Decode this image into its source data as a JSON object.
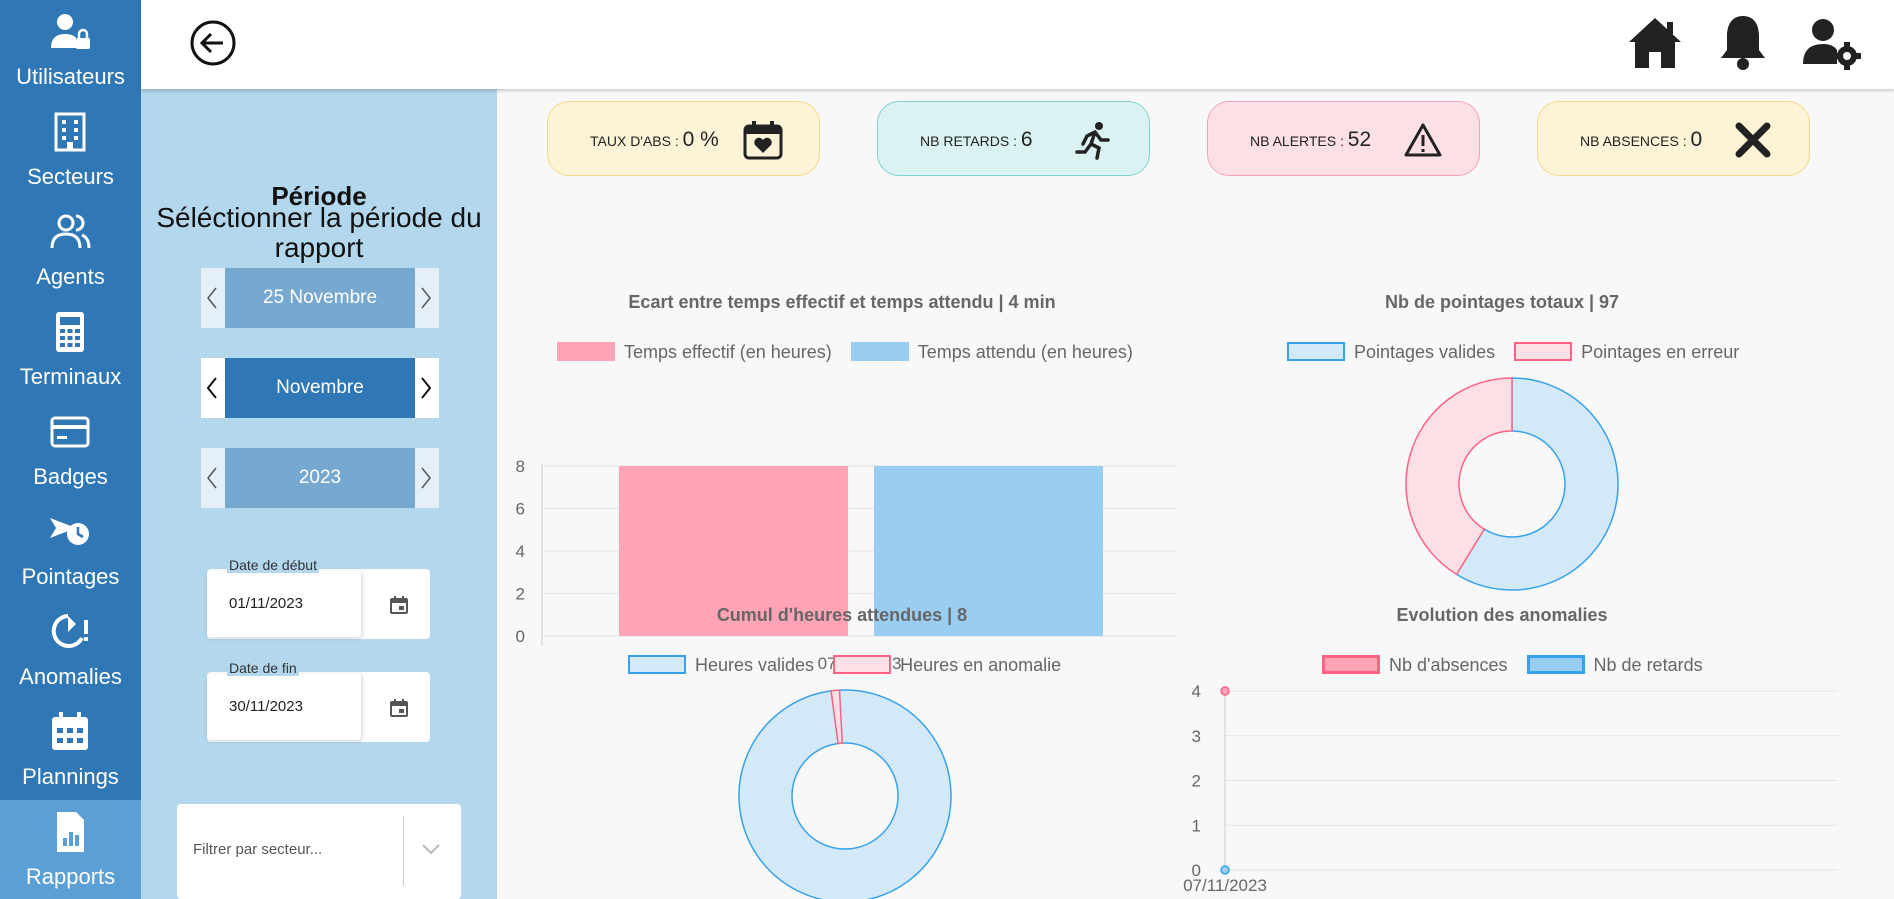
{
  "nav": [
    {
      "label": "Utilisateurs",
      "icon": "user-lock-icon"
    },
    {
      "label": "Secteurs",
      "icon": "building-icon"
    },
    {
      "label": "Agents",
      "icon": "users-icon"
    },
    {
      "label": "Terminaux",
      "icon": "calculator-icon"
    },
    {
      "label": "Badges",
      "icon": "card-icon"
    },
    {
      "label": "Pointages",
      "icon": "clock-arrow-icon"
    },
    {
      "label": "Anomalies",
      "icon": "pie-alert-icon"
    },
    {
      "label": "Plannings",
      "icon": "calendar-icon"
    },
    {
      "label": "Rapports",
      "icon": "report-icon"
    }
  ],
  "period": {
    "title": "Période",
    "subtitle": "Séléctionner la période du rapport",
    "day": "25 Novembre",
    "month": "Novembre",
    "year": "2023",
    "start_label": "Date de début",
    "start_value": "01/11/2023",
    "end_label": "Date de fin",
    "end_value": "30/11/2023",
    "filter_placeholder": "Filtrer par secteur..."
  },
  "kpis": [
    {
      "label": "TAUX D'ABS :",
      "value": "0 %",
      "icon": "calendar-heart-icon",
      "bg": "#fdf4d7",
      "border": "#f5d98a"
    },
    {
      "label": "NB RETARDS :",
      "value": "6",
      "icon": "running-icon",
      "bg": "#daf2f1",
      "border": "#7fd3cf"
    },
    {
      "label": "NB ALERTES :",
      "value": "52",
      "icon": "warning-icon",
      "bg": "#fde0e6",
      "border": "#f5a3b5"
    },
    {
      "label": "NB ABSENCES :",
      "value": "0",
      "icon": "x-icon",
      "bg": "#fdf4d7",
      "border": "#f5d98a"
    }
  ],
  "colors": {
    "pink": "#ffa3b7",
    "blue": "#99cdf2",
    "lightblue": "#d4e9f8",
    "lightpink": "#fde0e6",
    "border_blue": "#36a2eb",
    "border_pink": "#ff6384"
  },
  "chart_data": [
    {
      "type": "bar",
      "title": "Ecart entre temps effectif et temps attendu | 4 min",
      "categories": [
        "07/11/2023"
      ],
      "series": [
        {
          "name": "Temps effectif (en heures)",
          "values": [
            8
          ]
        },
        {
          "name": "Temps attendu (en heures)",
          "values": [
            8
          ]
        }
      ],
      "ylim": [
        0,
        8
      ],
      "yticks": [
        "0",
        "2",
        "4",
        "6",
        "8"
      ]
    },
    {
      "type": "pie",
      "title": "Nb de pointages totaux | 97",
      "labels": [
        "Pointages valides",
        "Pointages en erreur"
      ],
      "values": [
        57,
        40
      ]
    },
    {
      "type": "pie",
      "title": "Cumul d'heures attendues | 8",
      "labels": [
        "Heures valides",
        "Heures en anomalie"
      ],
      "values": [
        7.9,
        0.1
      ]
    },
    {
      "type": "line",
      "title": "Evolution des anomalies",
      "x": [
        "07/11/2023"
      ],
      "series": [
        {
          "name": "Nb d'absences",
          "values": [
            4
          ]
        },
        {
          "name": "Nb de retards",
          "values": [
            0
          ]
        }
      ],
      "ylim": [
        0,
        4
      ],
      "yticks": [
        "0",
        "1",
        "2",
        "3",
        "4"
      ]
    }
  ]
}
